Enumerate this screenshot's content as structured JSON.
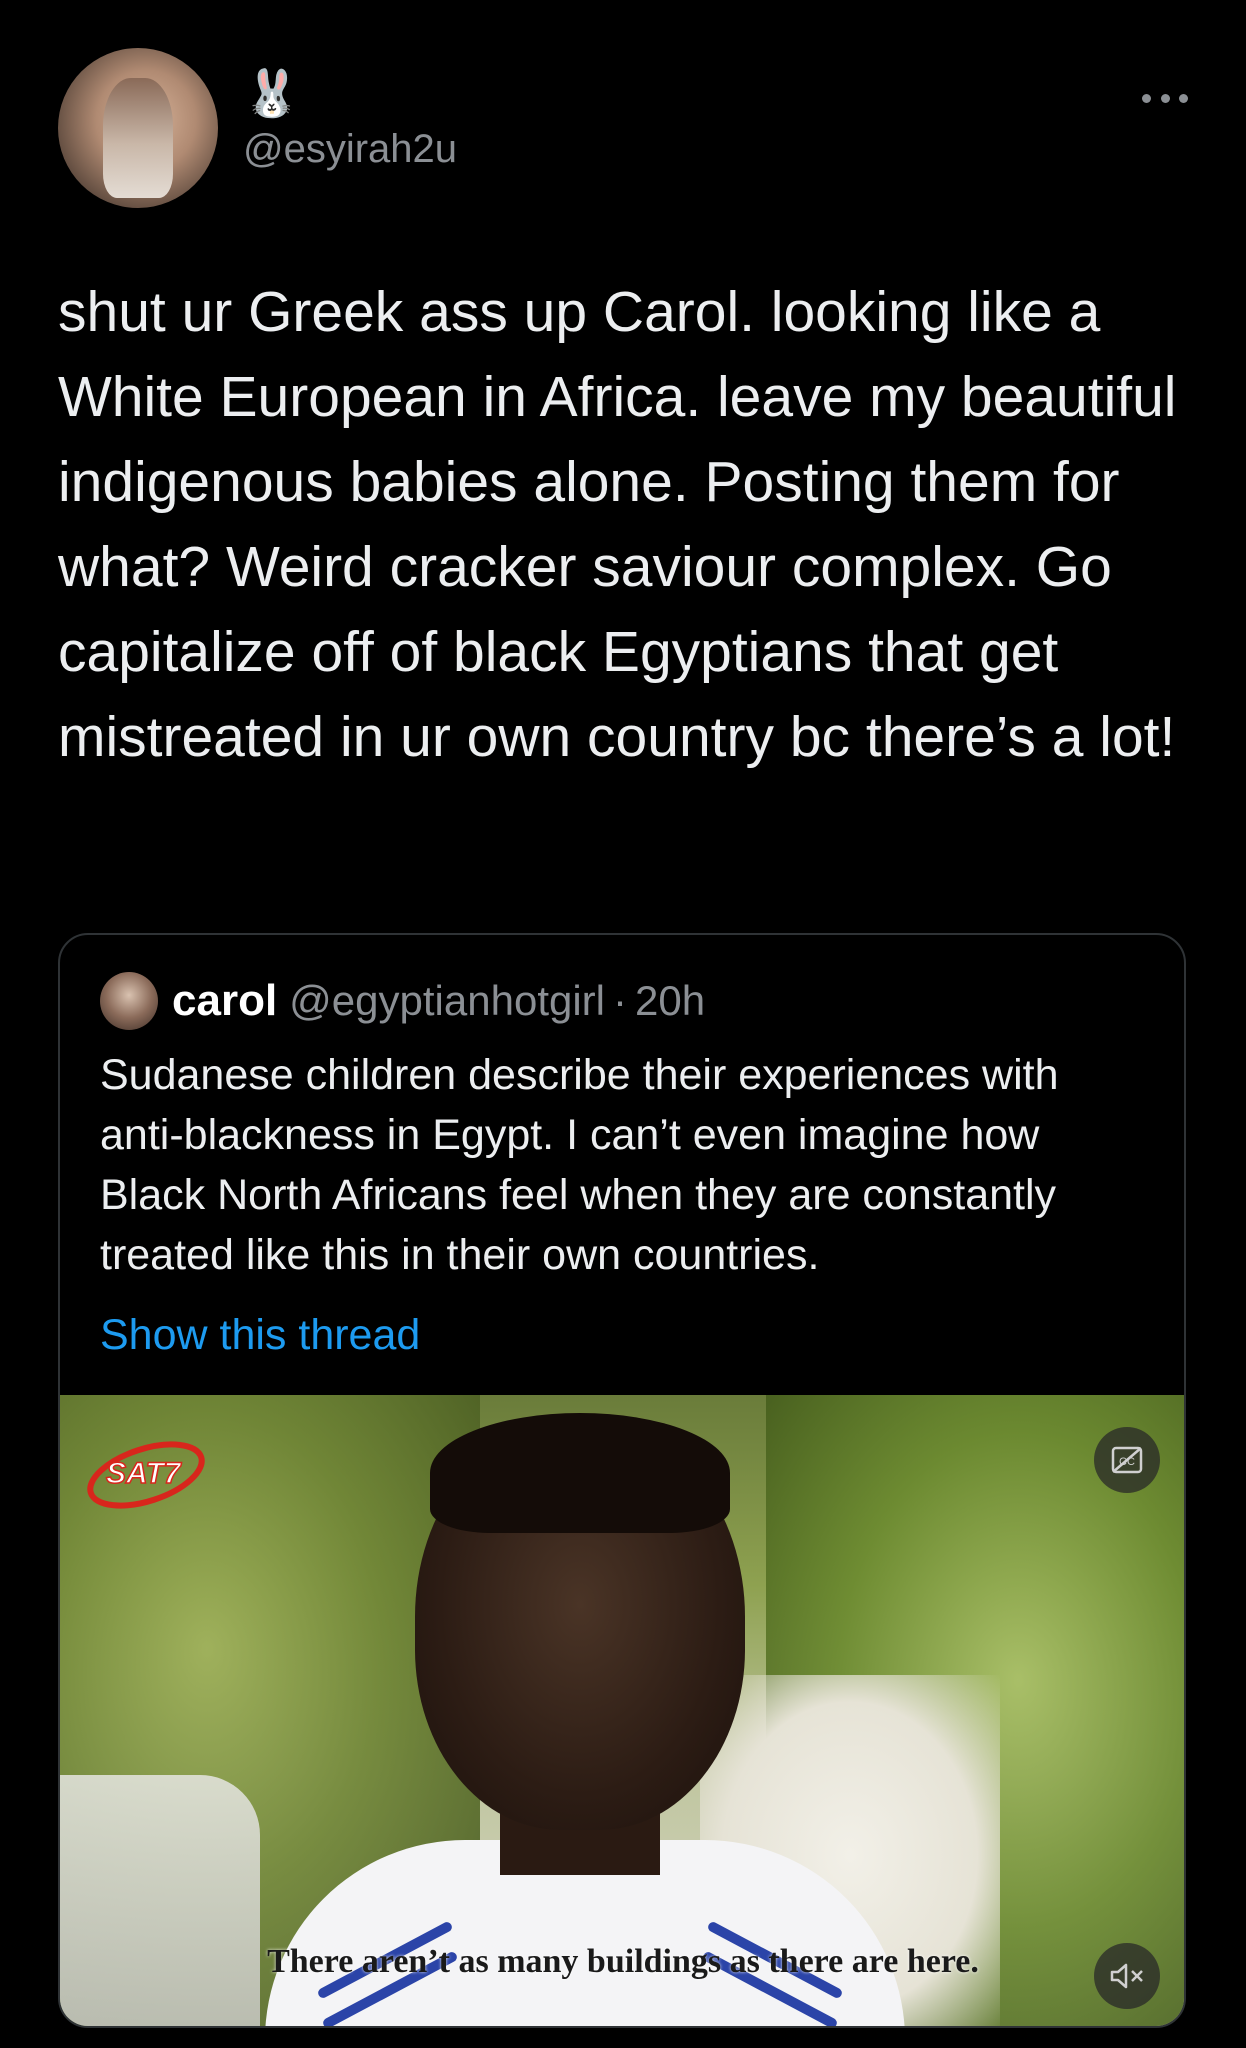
{
  "author": {
    "display_name": "🐰",
    "handle": "@esyirah2u",
    "avatar_icon": "profile-photo"
  },
  "tweet": {
    "text": "shut ur Greek ass up Carol. looking like a White European in Africa. leave my beautiful indigenous babies alone. Posting them for what? Weird cracker saviour complex. Go capitalize off of black Egyptians that get mistreated in ur own country bc there’s a lot!"
  },
  "more_icon": "more-horizontal-icon",
  "quoted": {
    "name": "carol",
    "handle": "@egyptianhotgirl",
    "separator": "·",
    "time": "20h",
    "text": "Sudanese children describe their experiences with anti-blackness in Egypt. I can’t even imagine how Black North Africans feel when they are constantly treated like this in their own countries.",
    "show_thread_label": "Show this thread",
    "media": {
      "logo_text": "SAT7",
      "subtitle": "There aren’t as many buildings as there are here.",
      "cc_icon": "closed-captions-off-icon",
      "mute_icon": "volume-muted-icon"
    }
  },
  "colors": {
    "background": "#000000",
    "text": "#eceef0",
    "secondary_text": "#8b8f94",
    "link": "#1d9bf0",
    "border": "#2f3336"
  }
}
